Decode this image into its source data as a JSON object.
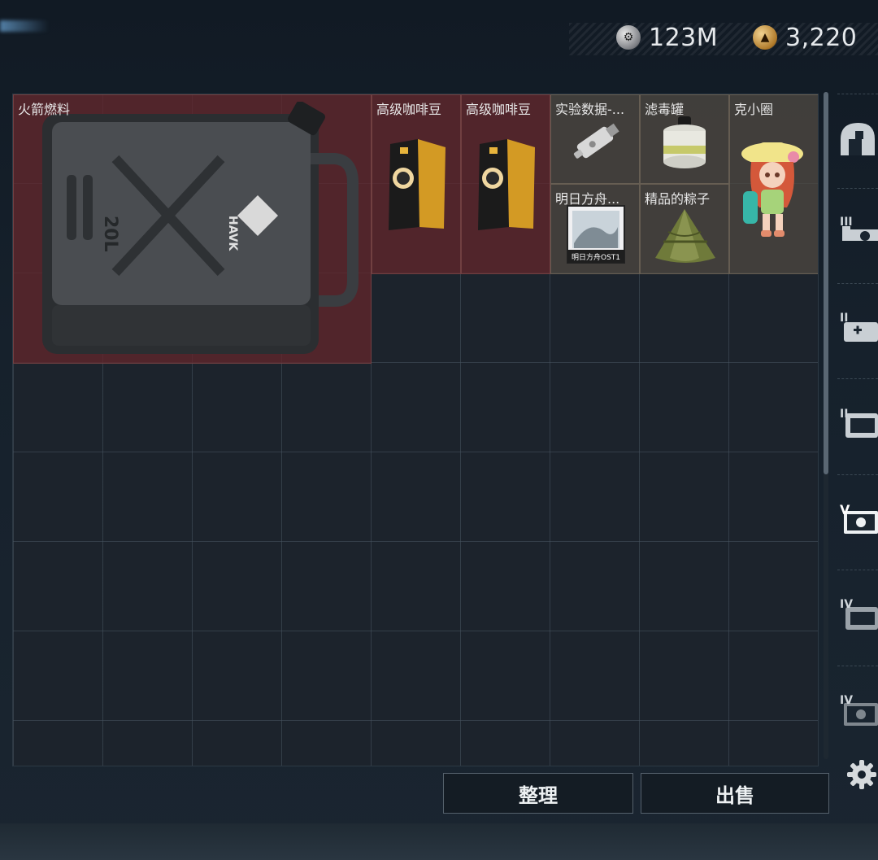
{
  "currencies": [
    {
      "icon": "silver-coin-icon",
      "value": "123M"
    },
    {
      "icon": "gold-coin-icon",
      "value": "3,220"
    }
  ],
  "items": [
    {
      "label": "火箭燃料",
      "icon": "fuel-jerrycan-icon",
      "can_text": "20L",
      "brand": "HAVK"
    },
    {
      "label": "高级咖啡豆",
      "icon": "coffee-bag-icon"
    },
    {
      "label": "高级咖啡豆",
      "icon": "coffee-bag-icon"
    },
    {
      "label": "实验数据-...",
      "icon": "usb-drive-icon"
    },
    {
      "label": "滤毒罐",
      "icon": "gas-filter-icon"
    },
    {
      "label": "克小圈",
      "icon": "doll-figure-icon"
    },
    {
      "label": "明日方舟...",
      "icon": "music-album-icon",
      "album_text": "明日方舟OST1"
    },
    {
      "label": "精品的粽子",
      "icon": "zongzi-icon"
    }
  ],
  "buttons": {
    "sort": "整理",
    "sell": "出售"
  },
  "side_tabs": [
    {
      "icon": "helmet-icon",
      "roman": ""
    },
    {
      "icon": "rifle-icon",
      "roman": "III"
    },
    {
      "icon": "medkit-icon",
      "roman": "II"
    },
    {
      "icon": "container-icon",
      "roman": "II"
    },
    {
      "icon": "safe-box-icon",
      "roman": "V"
    },
    {
      "icon": "container-icon",
      "roman": "IV"
    },
    {
      "icon": "safe-box-icon",
      "roman": "IV"
    }
  ],
  "colors": {
    "item_highlight": "#60262c",
    "item_neutral": "#4e4840",
    "grid_line": "#465460"
  }
}
